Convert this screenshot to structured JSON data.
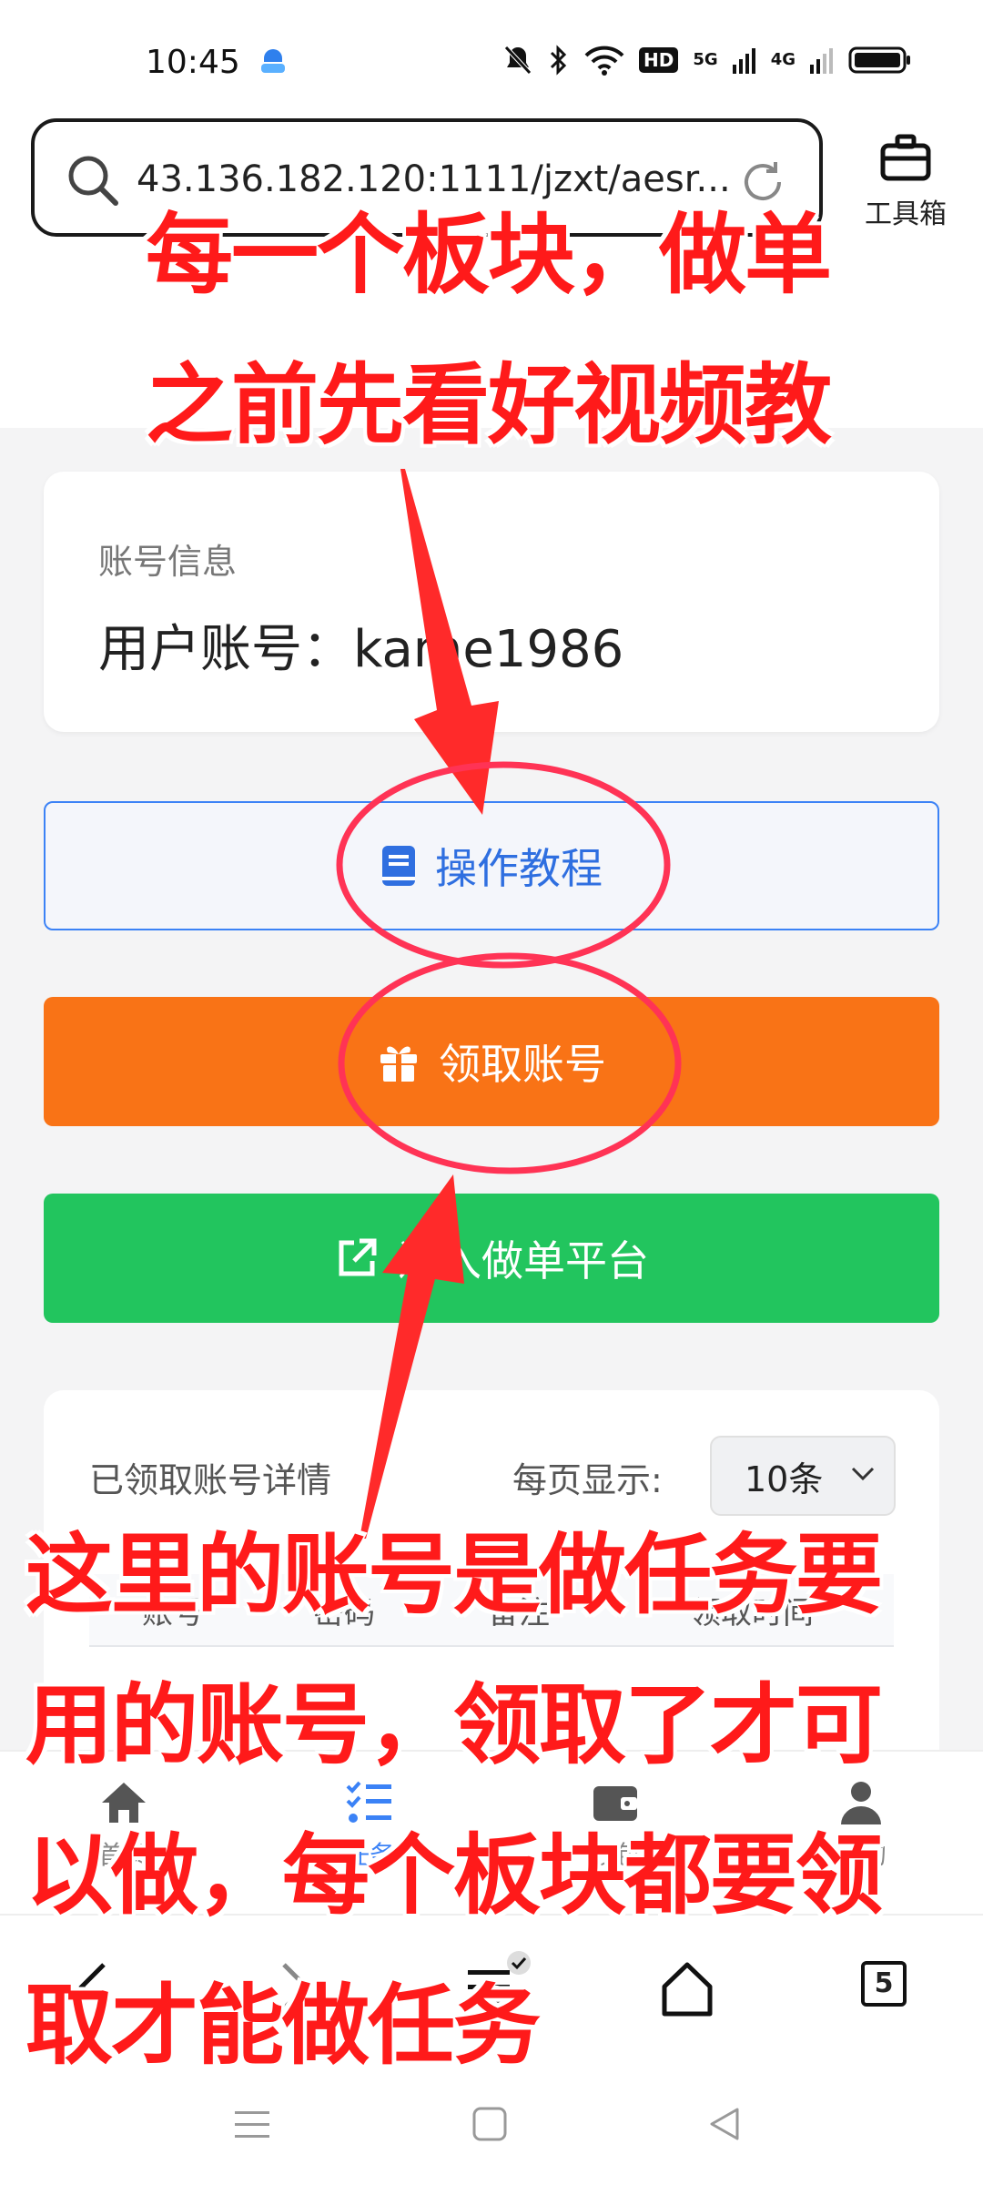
{
  "status": {
    "time": "10:45",
    "icons": [
      "mute-icon",
      "bluetooth-icon",
      "wifi-icon",
      "hd-icon",
      "signal-5g-icon",
      "signal-4g-icon",
      "battery-icon"
    ],
    "hd": "HD",
    "net1": "5G",
    "net2": "4G"
  },
  "browser": {
    "url": "43.136.182.120:1111/jzxt/aesr...",
    "toolbox_label": "工具箱",
    "tab_count": "5"
  },
  "account_card": {
    "title": "账号信息",
    "account_label": "用户账号：",
    "account_value": "kame1986"
  },
  "buttons": {
    "tutorial": "操作教程",
    "claim": "领取账号",
    "platform": "进入做单平台"
  },
  "details": {
    "title": "已领取账号详情",
    "perpage_label": "每页显示:",
    "perpage_value": "10条",
    "columns": [
      "账号",
      "密码",
      "备注",
      "领取时间"
    ]
  },
  "appnav": [
    {
      "label": "首页",
      "icon": "home-icon"
    },
    {
      "label": "任务",
      "icon": "task-list-icon"
    },
    {
      "label": "钱包",
      "icon": "wallet-icon"
    },
    {
      "label": "我的",
      "icon": "user-icon"
    }
  ],
  "annotations": {
    "top_line1": "每一个板块，做单",
    "top_line2": "之前先看好视频教",
    "bottom_line1": "这里的账号是做任务要",
    "bottom_line2": "用的账号，领取了才可",
    "bottom_line3": "以做，每个板块都要领",
    "bottom_line4": "取才能做任务"
  },
  "colors": {
    "annotation": "#ff1a1a",
    "tutorial_border": "#3b82f6",
    "claim_bg": "#f97316",
    "platform_bg": "#22c55e"
  }
}
